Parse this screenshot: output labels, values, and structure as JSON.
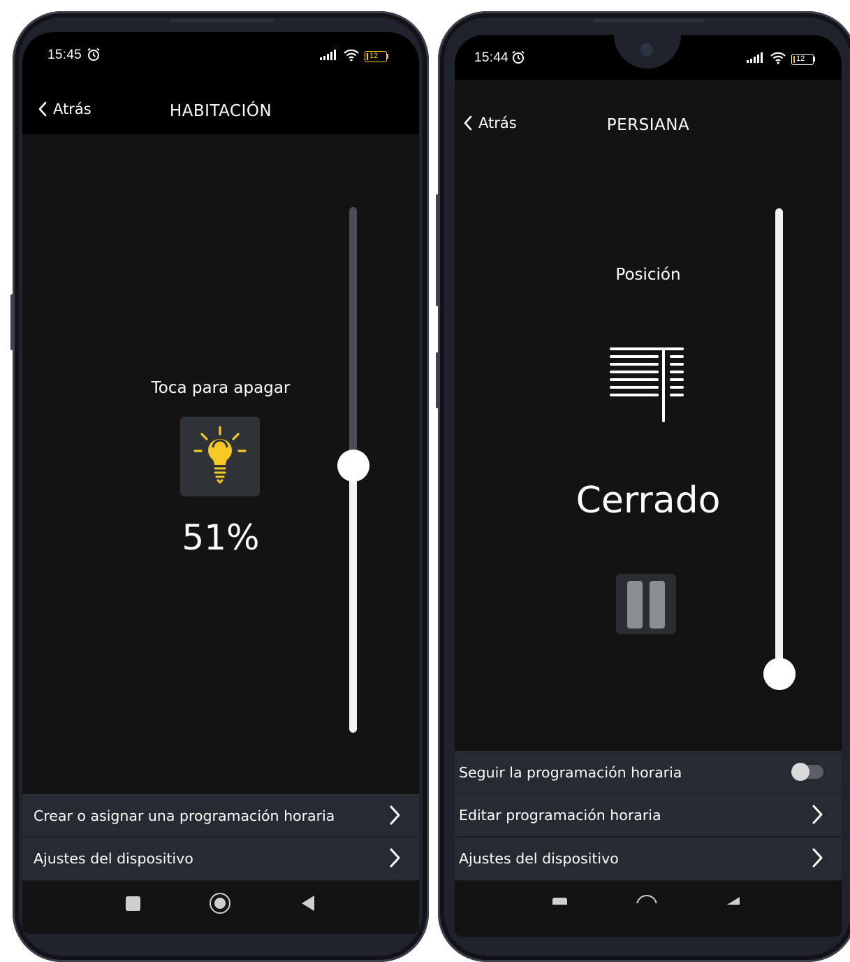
{
  "left_screen": {
    "status": {
      "time": "15:45",
      "battery": "12"
    },
    "nav": {
      "back_label": "Atrás",
      "title": "HABITACIÓN"
    },
    "hint": "Toca para apagar",
    "level": "51%",
    "slider_level_percent": 51,
    "icon": "lightbulb-icon",
    "bulb_color": "#f5c825",
    "rows": [
      {
        "label": "Crear o asignar una programación horaria"
      },
      {
        "label": "Ajustes del dispositivo"
      }
    ]
  },
  "right_screen": {
    "status": {
      "time": "15:44",
      "battery": "12"
    },
    "nav": {
      "back_label": "Atrás",
      "title": "PERSIANA"
    },
    "position_label": "Posición",
    "state": "Cerrado",
    "slider_level_percent": 0,
    "icon": "blinds-icon",
    "toggle": {
      "label": "Seguir la programación horaria",
      "on": false
    },
    "rows": [
      {
        "label": "Editar programación horaria"
      },
      {
        "label": "Ajustes del dispositivo"
      }
    ]
  },
  "colors": {
    "screen_bg": "#131313",
    "row_bg": "#252b30",
    "track_active": "#f2f2f2",
    "track_inactive": "#4a4d52"
  }
}
